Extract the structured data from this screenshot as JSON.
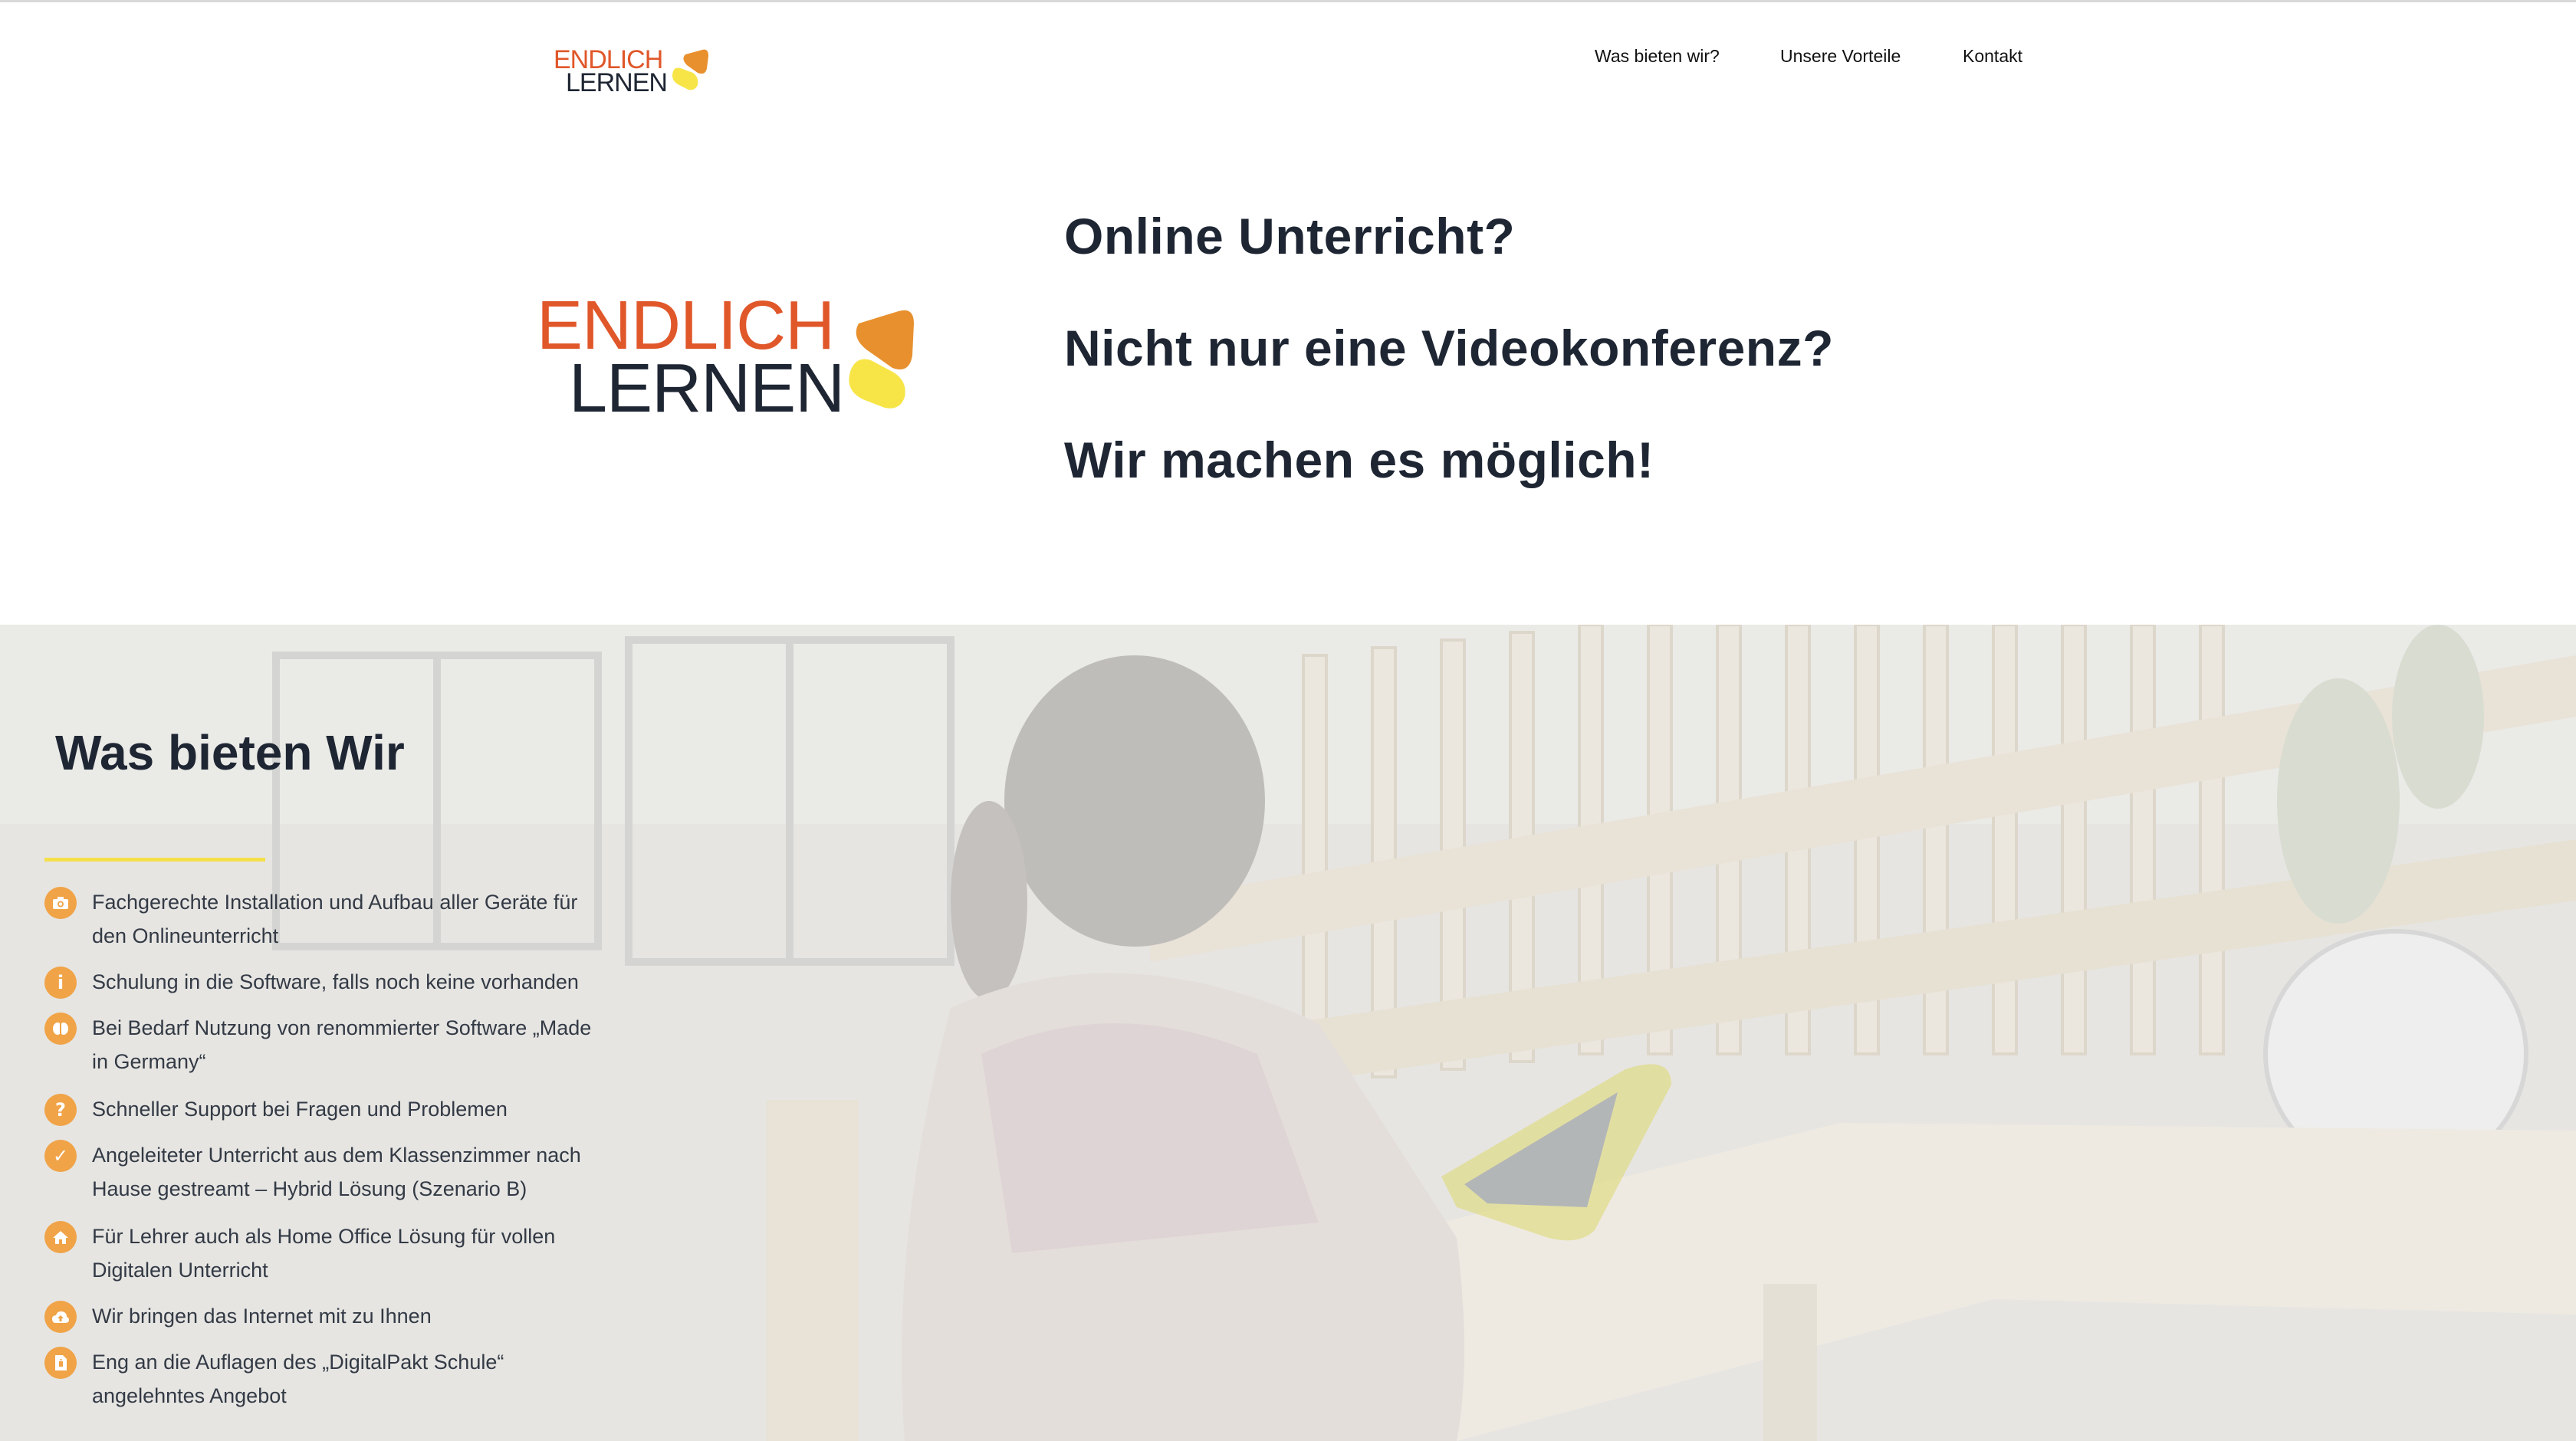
{
  "brand": {
    "word1": "ENDLICH",
    "word2": "LERNEN",
    "colors": {
      "orange_red": "#e0572a",
      "dark": "#1f2633",
      "orange": "#e8902e",
      "yellow": "#f7e548"
    }
  },
  "nav": {
    "items": [
      {
        "label": "Was bieten wir?"
      },
      {
        "label": "Unsere Vorteile"
      },
      {
        "label": "Kontakt"
      }
    ]
  },
  "hero": {
    "lines": [
      "Online Unterricht?",
      "Nicht nur eine Videokonferenz?",
      "Wir machen es möglich!"
    ]
  },
  "features": {
    "title": "Was bieten Wir",
    "accent_color": "#f0a347",
    "underline_color": "#f5e04a",
    "items": [
      {
        "icon": "camera-icon",
        "text": "Fachgerechte Installation und Aufbau aller Geräte für den Onlineunterricht"
      },
      {
        "icon": "info-icon",
        "text": "Schulung in die Software, falls noch keine vorhanden"
      },
      {
        "icon": "brain-icon",
        "text": "Bei Bedarf Nutzung von renommierter Software „Made in Germany“"
      },
      {
        "icon": "question-icon",
        "text": "Schneller Support bei Fragen und Problemen"
      },
      {
        "icon": "check-icon",
        "text": "Angeleiteter Unterricht aus dem Klassenzimmer nach Hause gestreamt –  Hybrid Lösung (Szenario B)"
      },
      {
        "icon": "home-icon",
        "text": "Für Lehrer auch als Home Office Lösung für vollen Digitalen Unterricht"
      },
      {
        "icon": "cloud-upload-icon",
        "text": "Wir bringen das Internet mit zu Ihnen"
      },
      {
        "icon": "document-icon",
        "text": "Eng an die Auflagen des „DigitalPakt Schule“ angelehntes Angebot"
      }
    ]
  }
}
